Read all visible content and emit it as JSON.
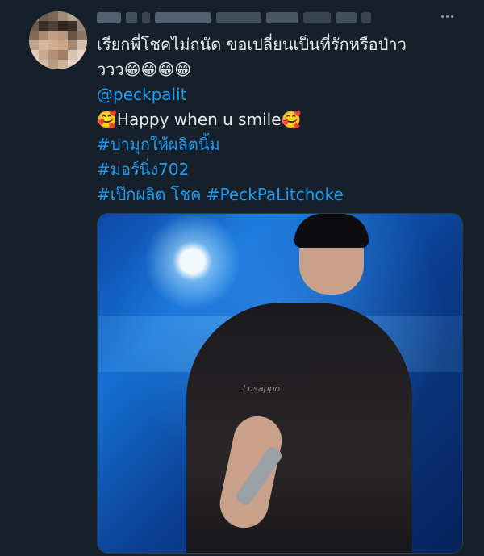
{
  "tweet": {
    "author_name_hidden": true,
    "more_icon": "more-dots-icon",
    "lines": [
      "เรียกพี่โชคไม่ถนัด ขอเปลี่ยนเป็นที่รักหรือป่าว",
      "ววว😁😁😁😁",
      "@peckpalit",
      "🥰Happy when u smile🥰",
      "#ปามุกให้ผลิตนิ้ม",
      "#มอร์นิ่ง702",
      "#เป๊กผลิต โชค #PeckPaLitchoke"
    ],
    "watermark": "Lusappo",
    "colors": {
      "background": "#15202b",
      "text": "#e7e9ea",
      "link": "#1d9bf0"
    }
  }
}
